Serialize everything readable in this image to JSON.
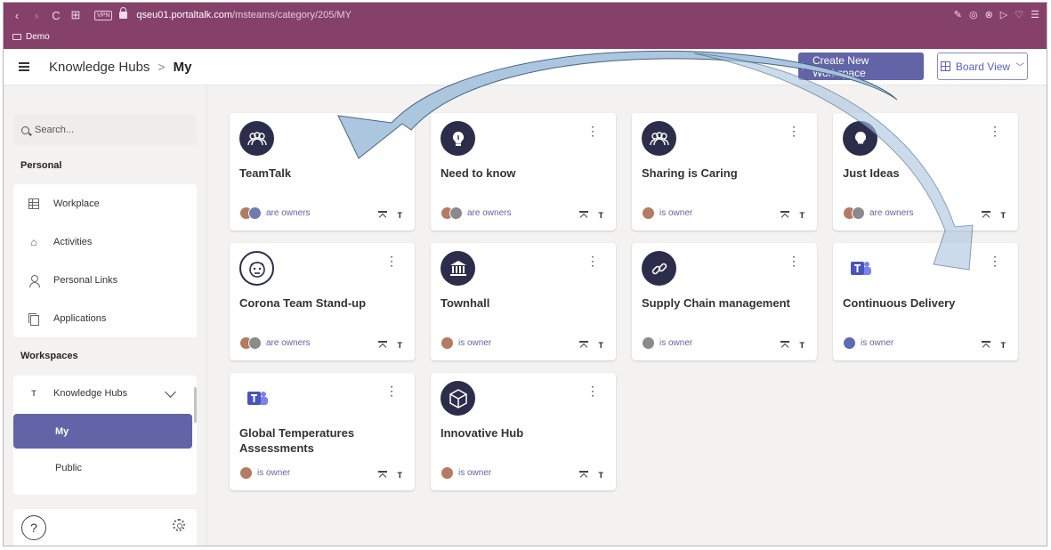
{
  "browser": {
    "nav_back": "‹",
    "nav_forward": "›",
    "reload": "C",
    "tabs_glyph": "⊞",
    "vpn_label": "VPN",
    "url_host": "qseu01.portaltalk.com",
    "url_path": "/msteams/category/205/MY",
    "bookmark_folder": "Demo",
    "right_icons": [
      "✎",
      "◎",
      "⊗",
      "▷",
      "♡",
      "☰"
    ]
  },
  "header": {
    "breadcrumb_root": "Knowledge Hubs",
    "breadcrumb_separator": ">",
    "breadcrumb_current": "My",
    "create_button": "Create New Workspace",
    "create_plus": "+",
    "board_view": "Board View"
  },
  "sidebar": {
    "search_placeholder": "Search...",
    "personal_title": "Personal",
    "personal_items": [
      {
        "label": "Workplace",
        "icon": "grid-icon"
      },
      {
        "label": "Activities",
        "icon": "home-icon"
      },
      {
        "label": "Personal Links",
        "icon": "person-icon"
      },
      {
        "label": "Applications",
        "icon": "apps-icon"
      }
    ],
    "workspaces_title": "Workspaces",
    "knowledge_hubs_label": "Knowledge Hubs",
    "my_label": "My",
    "public_label": "Public",
    "help_label": "?"
  },
  "cards": [
    {
      "title": "TeamTalk",
      "owners": "are owners",
      "icon": "team-icon"
    },
    {
      "title": "Need to know",
      "owners": "are owners",
      "icon": "lightbulb-icon"
    },
    {
      "title": "Sharing is Caring",
      "owners": "is owner",
      "icon": "team-icon"
    },
    {
      "title": "Just Ideas",
      "owners": "are owners",
      "icon": "idea-icon"
    },
    {
      "title": "Corona Team Stand-up",
      "owners": "are owners",
      "icon": "face-icon"
    },
    {
      "title": "Townhall",
      "owners": "is owner",
      "icon": "building-icon"
    },
    {
      "title": "Supply Chain management",
      "owners": "is owner",
      "icon": "chain-icon"
    },
    {
      "title": "Continuous Delivery",
      "owners": "is owner",
      "icon": "teams-icon"
    },
    {
      "title": "Global Temperatures Assessments",
      "owners": "is owner",
      "icon": "teams-icon"
    },
    {
      "title": "Innovative Hub",
      "owners": "is owner",
      "icon": "cube-icon"
    }
  ],
  "colors": {
    "browser_bar": "#86416a",
    "accent": "#6264a7",
    "icon_circle": "#2b2d4a",
    "arrow_fill": "#a9c4de",
    "arrow_stroke": "#3b5d80"
  }
}
